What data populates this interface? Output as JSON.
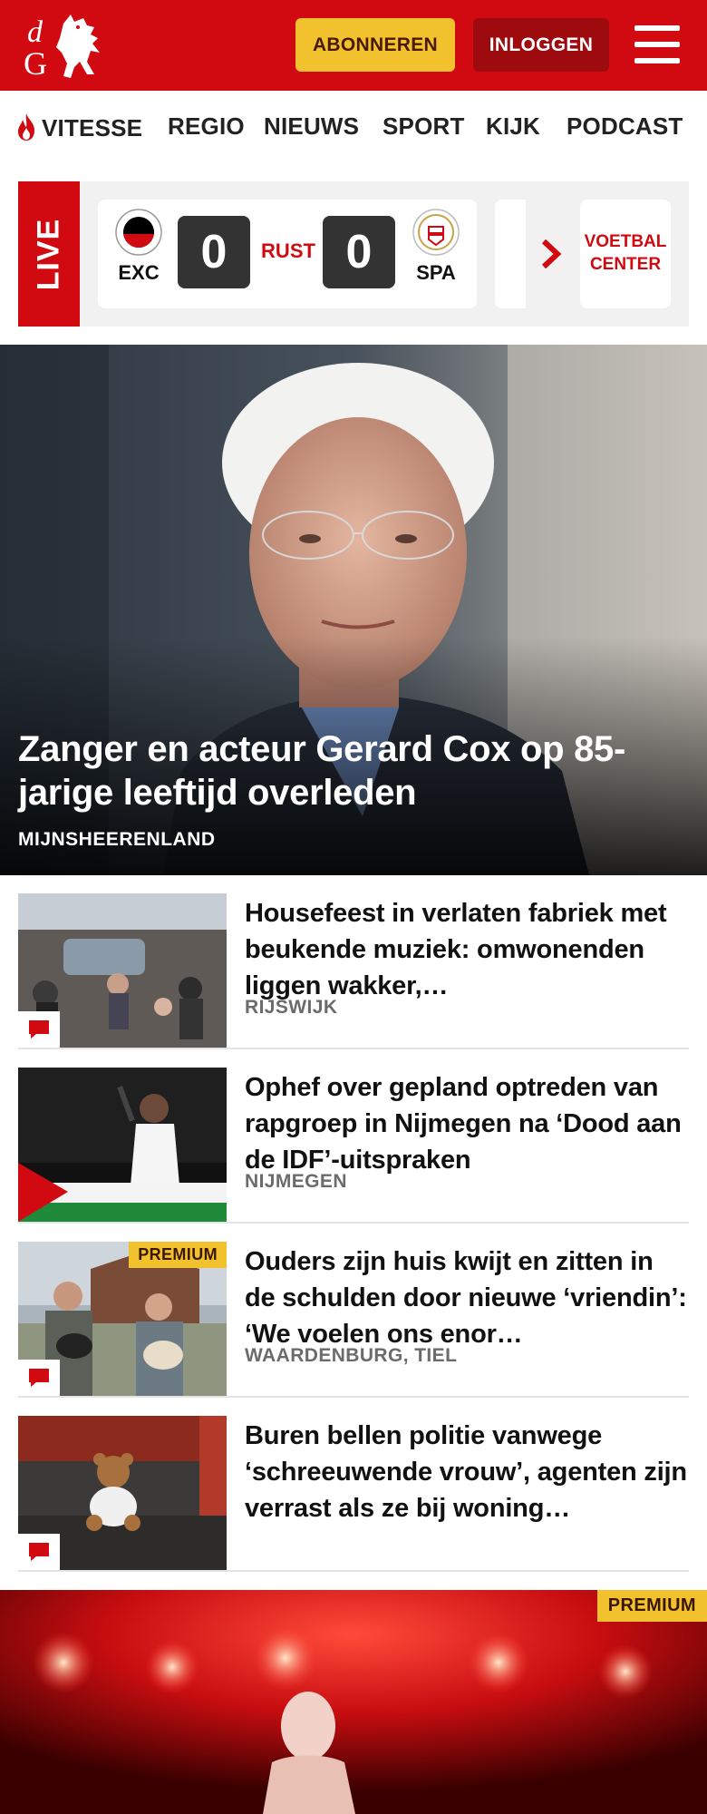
{
  "header": {
    "logo_text": "dG",
    "subscribe_label": "ABONNEREN",
    "login_label": "INLOGGEN",
    "menu_icon": "hamburger-menu-icon",
    "brand_color": "#d10a11",
    "accent_color": "#f2c12e"
  },
  "nav": {
    "items": [
      {
        "label": "VITESSE",
        "icon": "flame-icon"
      },
      {
        "label": "REGIO"
      },
      {
        "label": "NIEUWS"
      },
      {
        "label": "SPORT"
      },
      {
        "label": "KIJK"
      },
      {
        "label": "PODCAST"
      }
    ]
  },
  "live": {
    "tag": "LIVE",
    "match": {
      "home": "EXC",
      "home_score": "0",
      "status": "RUST",
      "away_score": "0",
      "away": "SPA"
    },
    "center_label": "VOETBAL CENTER"
  },
  "hero": {
    "title": "Zanger en acteur Gerard Cox op 85-jarige leeftijd overleden",
    "location": "MIJNSHEERENLAND"
  },
  "articles": [
    {
      "title": "Housefeest in verlaten fabriek met beukende muziek: omwonenden liggen wakker,…",
      "location": "RIJSWIJK",
      "comments": true,
      "premium": ""
    },
    {
      "title": "Ophef over gepland optreden van rapgroep in Nijmegen na ‘Dood aan de IDF’-uitspraken",
      "location": "NIJMEGEN",
      "comments": false,
      "premium": ""
    },
    {
      "title": "Ouders zijn huis kwijt en zitten in de schulden door nieuwe ‘vriendin’: ‘We voelen ons enor…",
      "location": "WAARDENBURG, TIEL",
      "comments": true,
      "premium": "PREMIUM"
    },
    {
      "title": "Buren bellen politie vanwege ‘schreeuwende vrouw’, agenten zijn verrast als ze bij woning…",
      "location": "",
      "comments": true,
      "premium": ""
    }
  ],
  "promo": {
    "premium": "PREMIUM"
  }
}
